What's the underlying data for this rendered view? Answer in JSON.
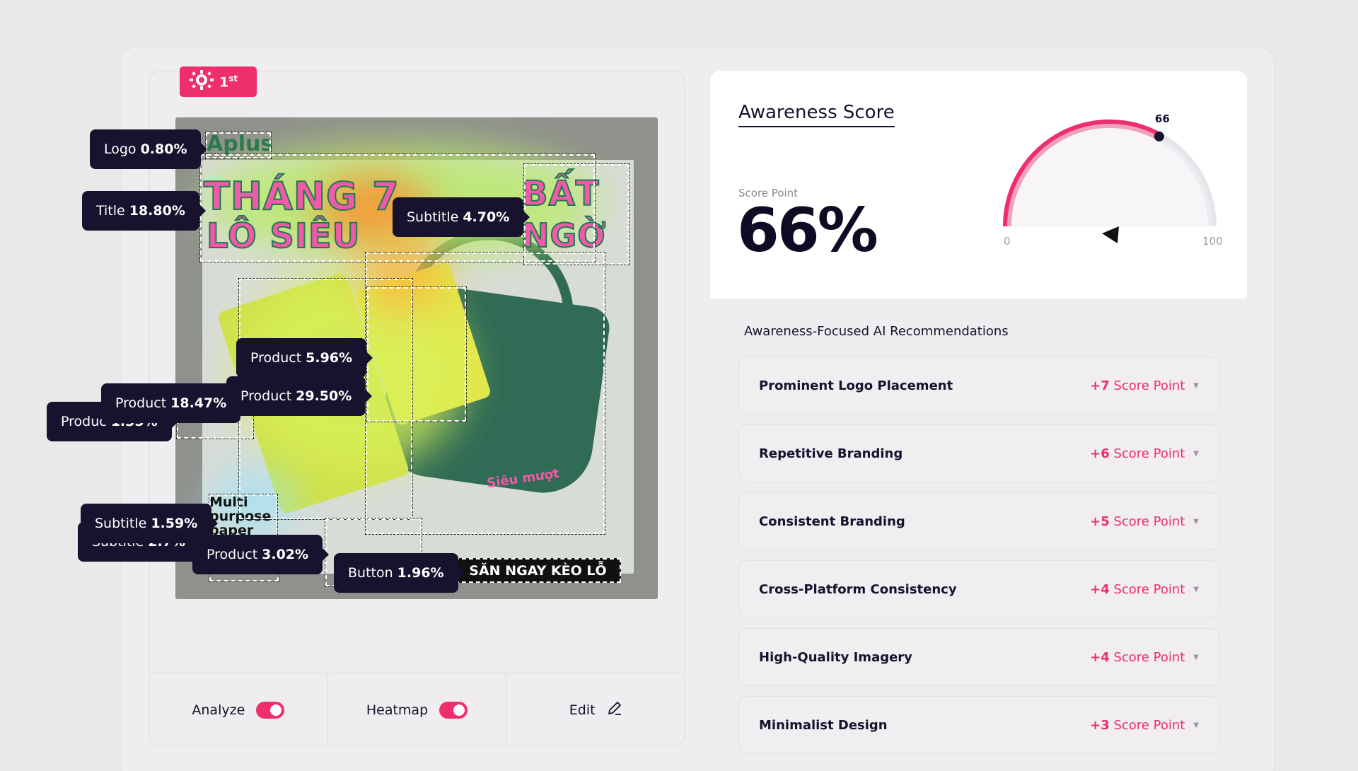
{
  "badge": {
    "rank": "1",
    "suffix": "st"
  },
  "ad": {
    "logo_text": "Aplus",
    "title_line1": "THÁNG 7",
    "title_line2": "LÔ SIÊU",
    "title_right1": "BẤT",
    "title_right2": "NGỜ",
    "cta": "SĂN NGAY KÈO LỖ",
    "basket_text": "Siêu mượt",
    "subtitle_box_text": "Multi purpose paper"
  },
  "tags": {
    "logo": {
      "label": "Logo",
      "value": "0.80%"
    },
    "title": {
      "label": "Title",
      "value": "18.80%"
    },
    "subtitle1": {
      "label": "Subtitle",
      "value": "4.70%"
    },
    "product1": {
      "label": "Product",
      "value": "5.96%"
    },
    "product2": {
      "label": "Product",
      "value": "29.50%"
    },
    "product3": {
      "label": "Product",
      "value": "18.47%"
    },
    "product4": {
      "label": "Produc",
      "value": "1.35%"
    },
    "subtitle2": {
      "label": "Subtitle",
      "value": "1.59%"
    },
    "subtitle3": {
      "label": "Subtitle",
      "value": "2.7%"
    },
    "product5": {
      "label": "Product",
      "value": "3.02%"
    },
    "button": {
      "label": "Button",
      "value": "1.96%"
    }
  },
  "toolbar": {
    "analyze": "Analyze",
    "heatmap": "Heatmap",
    "edit": "Edit"
  },
  "score": {
    "title": "Awareness Score",
    "caption": "Score Point",
    "value": "66%",
    "gauge_value": 66,
    "gauge_label": "66",
    "gauge_min": "0",
    "gauge_max": "100"
  },
  "recommendations": {
    "heading": "Awareness-Focused AI Recommendations",
    "unit": "Score Point",
    "items": [
      {
        "name": "Prominent Logo Placement",
        "points": "+7"
      },
      {
        "name": "Repetitive Branding",
        "points": "+6"
      },
      {
        "name": "Consistent Branding",
        "points": "+5"
      },
      {
        "name": "Cross-Platform Consistency",
        "points": "+4"
      },
      {
        "name": "High-Quality Imagery",
        "points": "+4"
      },
      {
        "name": "Minimalist Design",
        "points": "+3"
      }
    ]
  },
  "colors": {
    "accent": "#ee2f6b",
    "dark": "#17122e"
  },
  "icons": {
    "badge": "sun-medal-icon",
    "edit": "pencil-icon",
    "pointer": "cursor-arrow-icon"
  }
}
